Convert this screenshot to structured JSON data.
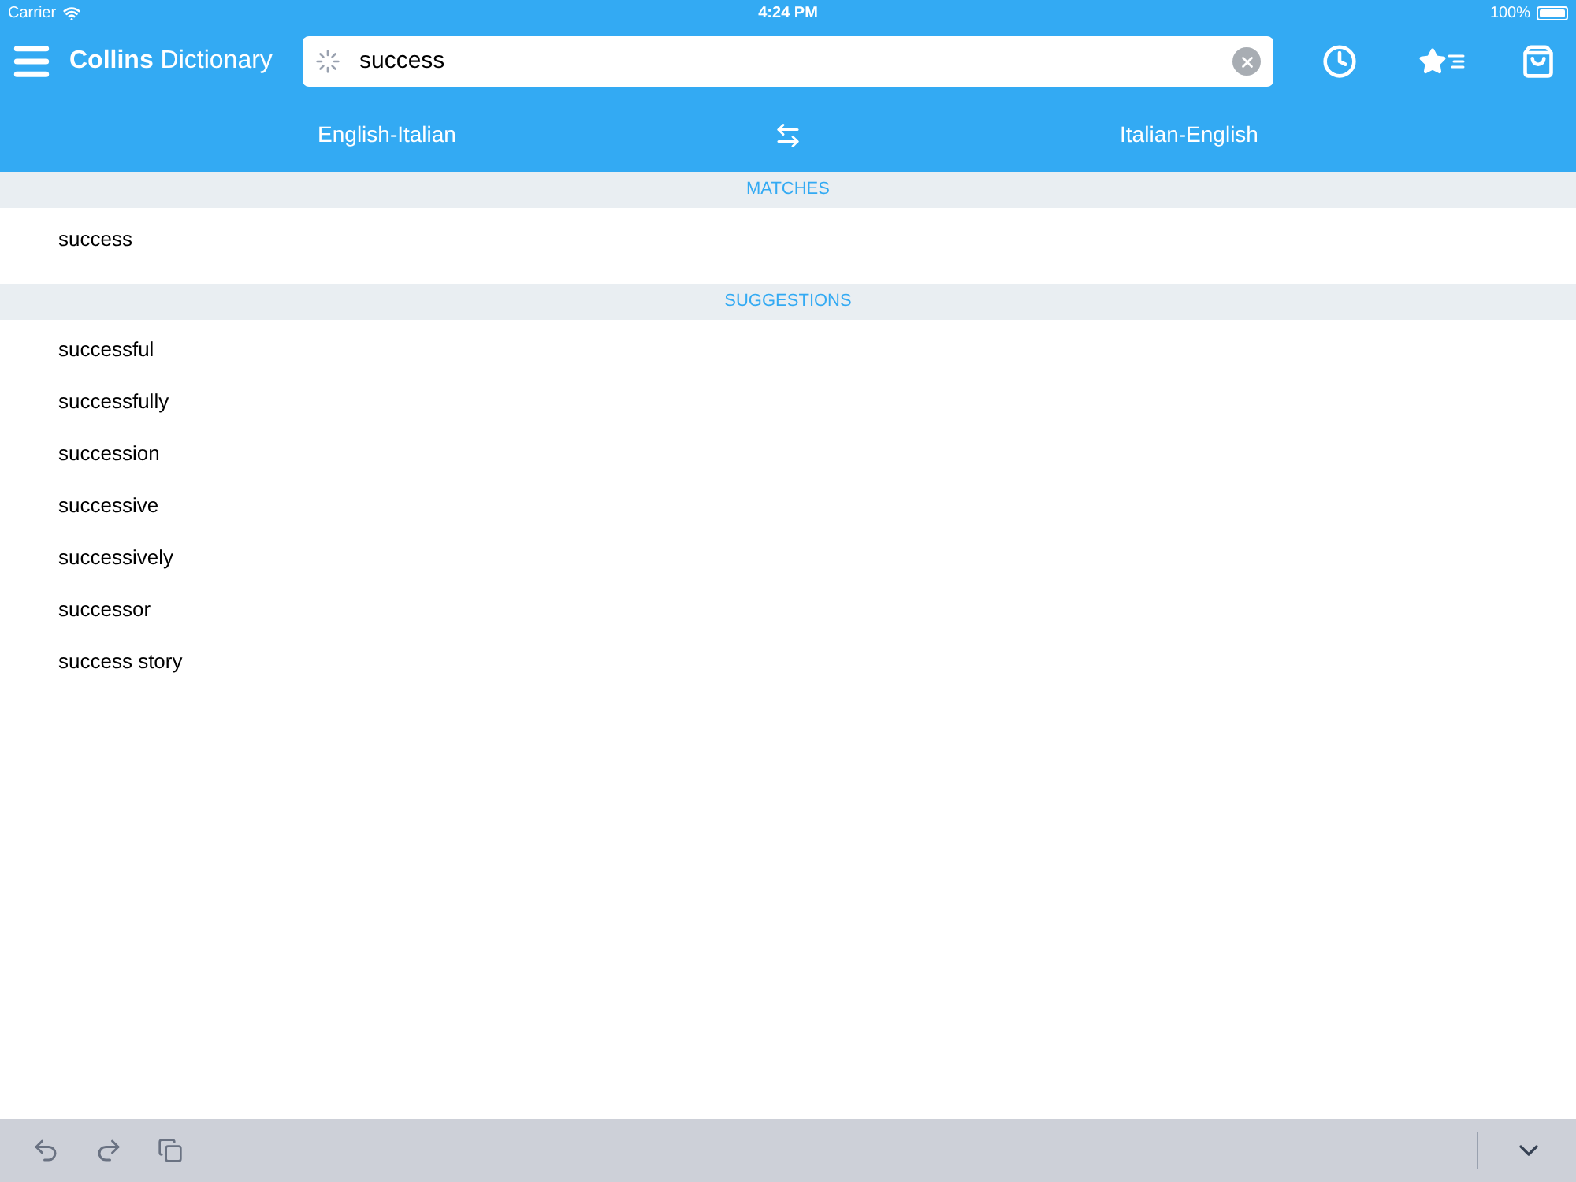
{
  "status_bar": {
    "carrier": "Carrier",
    "time": "4:24 PM",
    "battery": "100%"
  },
  "header": {
    "title": "**Collins** Dictionary",
    "search": {
      "value": "success"
    }
  },
  "directions": [
    "English-Italian",
    "Italian-English"
  ],
  "sections": [
    {
      "title": "MATCHES",
      "items": [
        "success"
      ]
    },
    {
      "title": "SUGGESTIONS",
      "items": [
        "successful",
        "successfully",
        "succession",
        "successive",
        "successively",
        "successor",
        "success story"
      ]
    }
  ]
}
